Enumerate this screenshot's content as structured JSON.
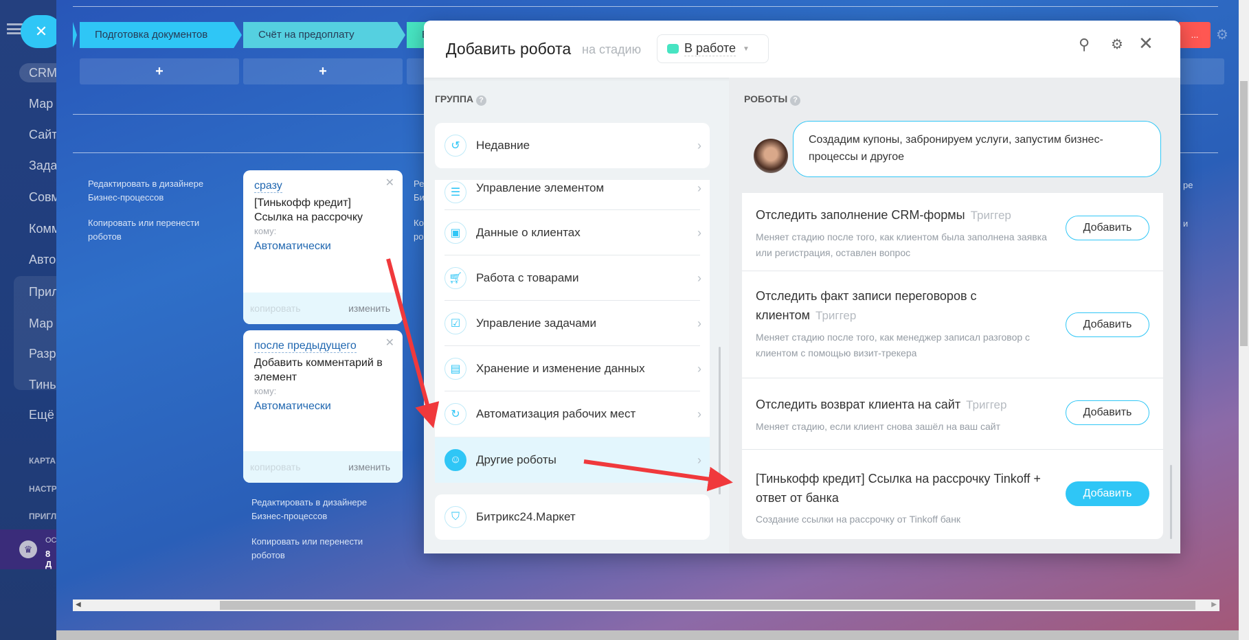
{
  "sidebar": {
    "items": [
      "CRM",
      "Мар",
      "Сайт",
      "Зада",
      "Совм",
      "Комм",
      "Авто",
      "Прил",
      "Мар",
      "Разр",
      "Тинь",
      "Ещё"
    ],
    "sections": [
      "КАРТА",
      "НАСТР",
      "ПРИГЛ"
    ],
    "banner": {
      "line1": "ОС",
      "line2": "8 Д"
    }
  },
  "stages": [
    "Подготовка документов",
    "Счёт на предоплату",
    "В"
  ],
  "stage_red": "...",
  "plus": "+",
  "links": {
    "edit": "Редактировать в дизайнере Бизнес-процессов",
    "copy": "Копировать или перенести роботов",
    "edit_right": "Ре Би",
    "copy_right": "Ко ро",
    "edit_far": "ре",
    "copy_far": "и"
  },
  "cards": [
    {
      "when": "сразу",
      "name": "[Тинькофф кредит] Ссылка на рассрочку",
      "to_label": "кому:",
      "to": "Автоматически",
      "copy": "копировать",
      "edit": "изменить"
    },
    {
      "when": "после предыдущего",
      "name": "Добавить комментарий в элемент",
      "to_label": "кому:",
      "to": "Автоматически",
      "copy": "копировать",
      "edit": "изменить"
    }
  ],
  "modal": {
    "title": "Добавить робота",
    "stage_prefix": "на стадию",
    "stage": "В работе",
    "stage_color": "#47e4c2",
    "group_label": "ГРУППА",
    "robots_label": "РОБОТЫ",
    "groups": [
      "Недавние",
      "Управление элементом",
      "Данные о клиентах",
      "Работа с товарами",
      "Управление задачами",
      "Хранение и изменение данных",
      "Автоматизация рабочих мест",
      "Другие роботы",
      "Битрикс24.Маркет"
    ],
    "hint": "Создадим купоны, забронируем услуги, запустим бизнес-процессы и другое",
    "robots": [
      {
        "title": "Отследить заполнение CRM-формы",
        "tag": "Триггер",
        "desc": "Меняет стадию после того, как клиентом была заполнена заявка или регистрация, оставлен вопрос",
        "button": "Добавить"
      },
      {
        "title": "Отследить факт записи переговоров с клиентом",
        "tag": "Триггер",
        "desc": "Меняет стадию после того, как менеджер записал разговор с клиентом с помощью визит-трекера",
        "button": "Добавить"
      },
      {
        "title": "Отследить возврат клиента на сайт",
        "tag": "Триггер",
        "desc": "Меняет стадию, если клиент снова зашёл на ваш сайт",
        "button": "Добавить"
      },
      {
        "title": "[Тинькофф кредит] Ссылка на рассрочку Tinkoff + ответ от банка",
        "tag": "",
        "desc": "Создание ссылки на рассрочку от Tinkoff банк",
        "button": "Добавить"
      }
    ]
  }
}
